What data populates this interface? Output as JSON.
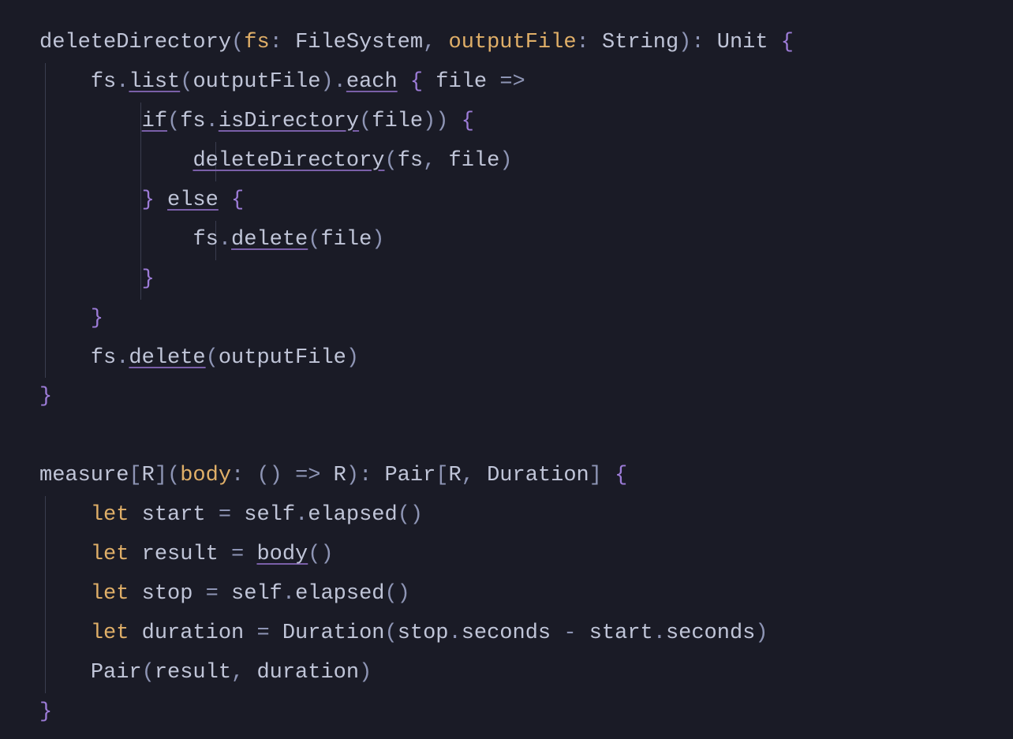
{
  "code": {
    "fn1": {
      "name": "deleteDirectory",
      "p1": "fs",
      "t1": "FileSystem",
      "p2": "outputFile",
      "t2": "String",
      "ret": "Unit",
      "list": "list",
      "each": "each",
      "file": "file",
      "if": "if",
      "isDirectory": "isDirectory",
      "deleteDirectory": "deleteDirectory",
      "else": "else",
      "delete": "delete"
    },
    "fn2": {
      "name": "measure",
      "R": "R",
      "body": "body",
      "bodyType": "() => R",
      "retPair": "Pair",
      "retDur": "Duration",
      "let": "let",
      "start": "start",
      "self": "self",
      "elapsed": "elapsed",
      "result": "result",
      "stop": "stop",
      "duration": "duration",
      "Duration": "Duration",
      "seconds": "seconds",
      "Pair": "Pair"
    }
  }
}
